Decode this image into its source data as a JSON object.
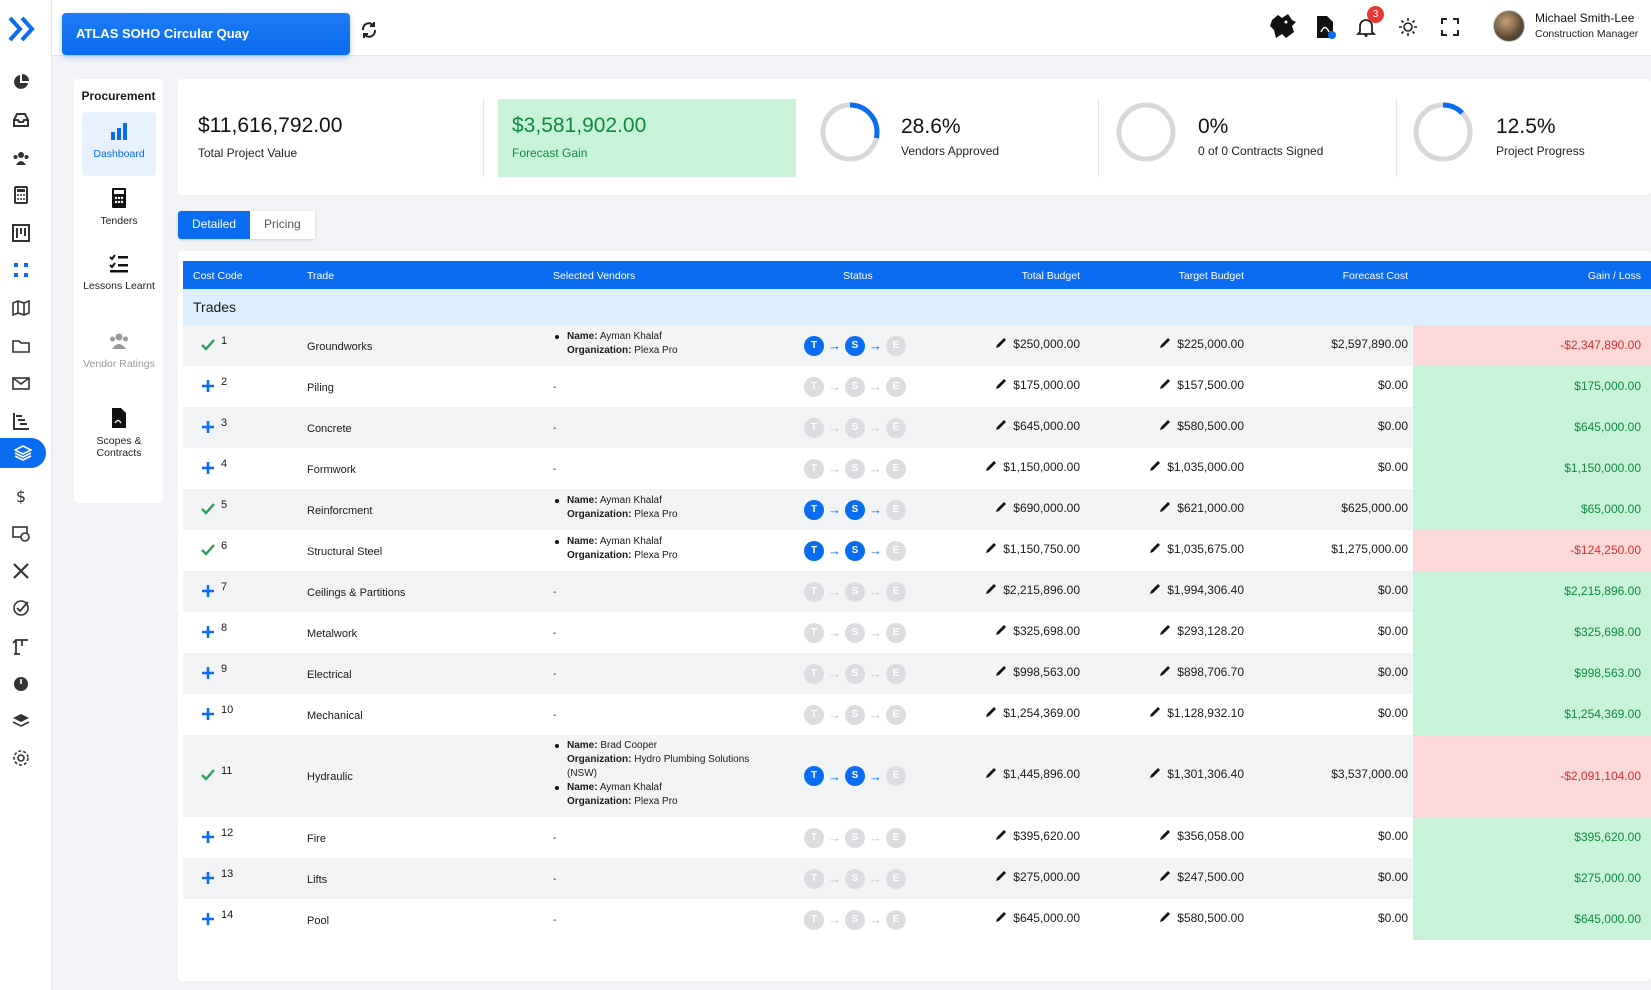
{
  "project": {
    "name": "ATLAS SOHO Circular Quay"
  },
  "user": {
    "name": "Michael Smith-Lee",
    "role": "Construction Manager",
    "notifications": "3"
  },
  "subnav": {
    "title": "Procurement",
    "items": [
      {
        "label": "Dashboard"
      },
      {
        "label": "Tenders"
      },
      {
        "label": "Lessons Learnt"
      },
      {
        "label": "Vendor Ratings"
      },
      {
        "label": "Scopes & Contracts"
      }
    ]
  },
  "stats": {
    "total_value": "$11,616,792.00",
    "total_value_label": "Total Project Value",
    "forecast_gain": "$3,581,902.00",
    "forecast_gain_label": "Forecast Gain",
    "vendors_pct": "28.6%",
    "vendors_label": "Vendors Approved",
    "vendors_fraction": 0.286,
    "contracts_pct": "0%",
    "contracts_label": "0 of 0 Contracts Signed",
    "contracts_fraction": 0,
    "progress_pct": "12.5%",
    "progress_label": "Project Progress",
    "progress_fraction": 0.125
  },
  "tabs": {
    "detailed": "Detailed",
    "pricing": "Pricing"
  },
  "table": {
    "headers": {
      "cost_code": "Cost Code",
      "trade": "Trade",
      "vendors": "Selected Vendors",
      "status": "Status",
      "total": "Total Budget",
      "target": "Target Budget",
      "forecast": "Forecast Cost",
      "gain": "Gain / Loss"
    },
    "group": "Trades",
    "status_letters": [
      "T",
      "S",
      "E"
    ],
    "vendor_name_label": "Name:",
    "vendor_org_label": "Organization:",
    "rows": [
      {
        "code": "1",
        "trade": "Groundworks",
        "selected": true,
        "vendors": [
          {
            "name": "Ayman Khalaf",
            "org": "Plexa Pro"
          }
        ],
        "total": "$250,000.00",
        "target": "$225,000.00",
        "forecast": "$2,597,890.00",
        "gain": "-$2,347,890.00",
        "neg": true
      },
      {
        "code": "2",
        "trade": "Piling",
        "selected": false,
        "vendors": [],
        "total": "$175,000.00",
        "target": "$157,500.00",
        "forecast": "$0.00",
        "gain": "$175,000.00",
        "neg": false
      },
      {
        "code": "3",
        "trade": "Concrete",
        "selected": false,
        "vendors": [],
        "total": "$645,000.00",
        "target": "$580,500.00",
        "forecast": "$0.00",
        "gain": "$645,000.00",
        "neg": false
      },
      {
        "code": "4",
        "trade": "Formwork",
        "selected": false,
        "vendors": [],
        "total": "$1,150,000.00",
        "target": "$1,035,000.00",
        "forecast": "$0.00",
        "gain": "$1,150,000.00",
        "neg": false
      },
      {
        "code": "5",
        "trade": "Reinforcment",
        "selected": true,
        "vendors": [
          {
            "name": "Ayman Khalaf",
            "org": "Plexa Pro"
          }
        ],
        "total": "$690,000.00",
        "target": "$621,000.00",
        "forecast": "$625,000.00",
        "gain": "$65,000.00",
        "neg": false
      },
      {
        "code": "6",
        "trade": "Structural Steel",
        "selected": true,
        "vendors": [
          {
            "name": "Ayman Khalaf",
            "org": "Plexa Pro"
          }
        ],
        "total": "$1,150,750.00",
        "target": "$1,035,675.00",
        "forecast": "$1,275,000.00",
        "gain": "-$124,250.00",
        "neg": true
      },
      {
        "code": "7",
        "trade": "Ceilings & Partitions",
        "selected": false,
        "vendors": [],
        "total": "$2,215,896.00",
        "target": "$1,994,306.40",
        "forecast": "$0.00",
        "gain": "$2,215,896.00",
        "neg": false
      },
      {
        "code": "8",
        "trade": "Metalwork",
        "selected": false,
        "vendors": [],
        "total": "$325,698.00",
        "target": "$293,128.20",
        "forecast": "$0.00",
        "gain": "$325,698.00",
        "neg": false
      },
      {
        "code": "9",
        "trade": "Electrical",
        "selected": false,
        "vendors": [],
        "total": "$998,563.00",
        "target": "$898,706.70",
        "forecast": "$0.00",
        "gain": "$998,563.00",
        "neg": false
      },
      {
        "code": "10",
        "trade": "Mechanical",
        "selected": false,
        "vendors": [],
        "total": "$1,254,369.00",
        "target": "$1,128,932.10",
        "forecast": "$0.00",
        "gain": "$1,254,369.00",
        "neg": false
      },
      {
        "code": "11",
        "trade": "Hydraulic",
        "selected": true,
        "vendors": [
          {
            "name": "Brad Cooper",
            "org": "Hydro Plumbing Solutions (NSW)"
          },
          {
            "name": "Ayman Khalaf",
            "org": "Plexa Pro"
          }
        ],
        "total": "$1,445,896.00",
        "target": "$1,301,306.40",
        "forecast": "$3,537,000.00",
        "gain": "-$2,091,104.00",
        "neg": true
      },
      {
        "code": "12",
        "trade": "Fire",
        "selected": false,
        "vendors": [],
        "total": "$395,620.00",
        "target": "$356,058.00",
        "forecast": "$0.00",
        "gain": "$395,620.00",
        "neg": false
      },
      {
        "code": "13",
        "trade": "Lifts",
        "selected": false,
        "vendors": [],
        "total": "$275,000.00",
        "target": "$247,500.00",
        "forecast": "$0.00",
        "gain": "$275,000.00",
        "neg": false
      },
      {
        "code": "14",
        "trade": "Pool",
        "selected": false,
        "vendors": [],
        "total": "$645,000.00",
        "target": "$580,500.00",
        "forecast": "$0.00",
        "gain": "$645,000.00",
        "neg": false
      }
    ],
    "empty_vendor": "-"
  },
  "colors": {
    "accent": "#0a6cf0",
    "gain": "#0f8a3c",
    "loss": "#d32f2f"
  },
  "icons": {
    "rail": [
      "pie-chart-icon",
      "inbox-icon",
      "team-icon",
      "calculator-icon",
      "kanban-icon",
      "workflow-icon",
      "map-icon",
      "folder-icon",
      "mail-icon",
      "gantt-icon",
      "layers-icon",
      "dollar-icon",
      "budget-icon",
      "tools-icon",
      "check-circle-icon",
      "crane-icon",
      "timer-icon",
      "stack-icon",
      "settings-icon"
    ]
  }
}
